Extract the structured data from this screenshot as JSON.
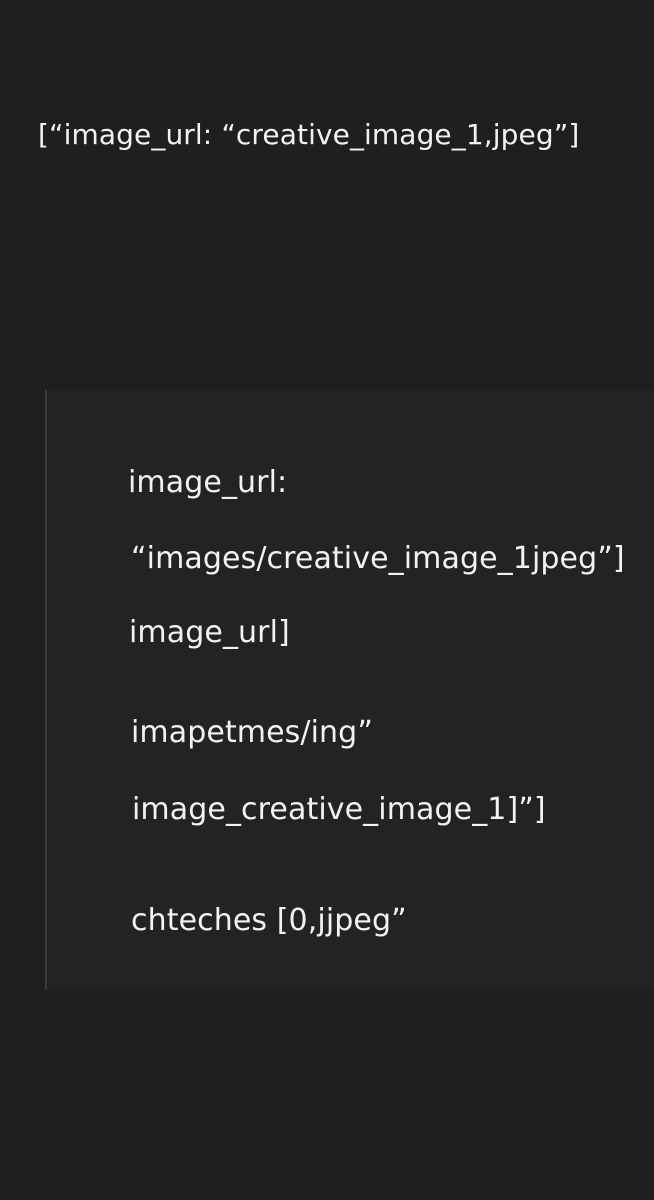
{
  "header": {
    "code_line": "[“image_url: “creative_image_1,jpeg”]"
  },
  "code_panel": {
    "lines": [
      "image_url:",
      "“images/creative_image_1jpeg”]",
      "image_url]",
      "imapetmes/ing”",
      "image_creative_image_1]”]",
      "chteches [0,jjpeg”"
    ]
  }
}
